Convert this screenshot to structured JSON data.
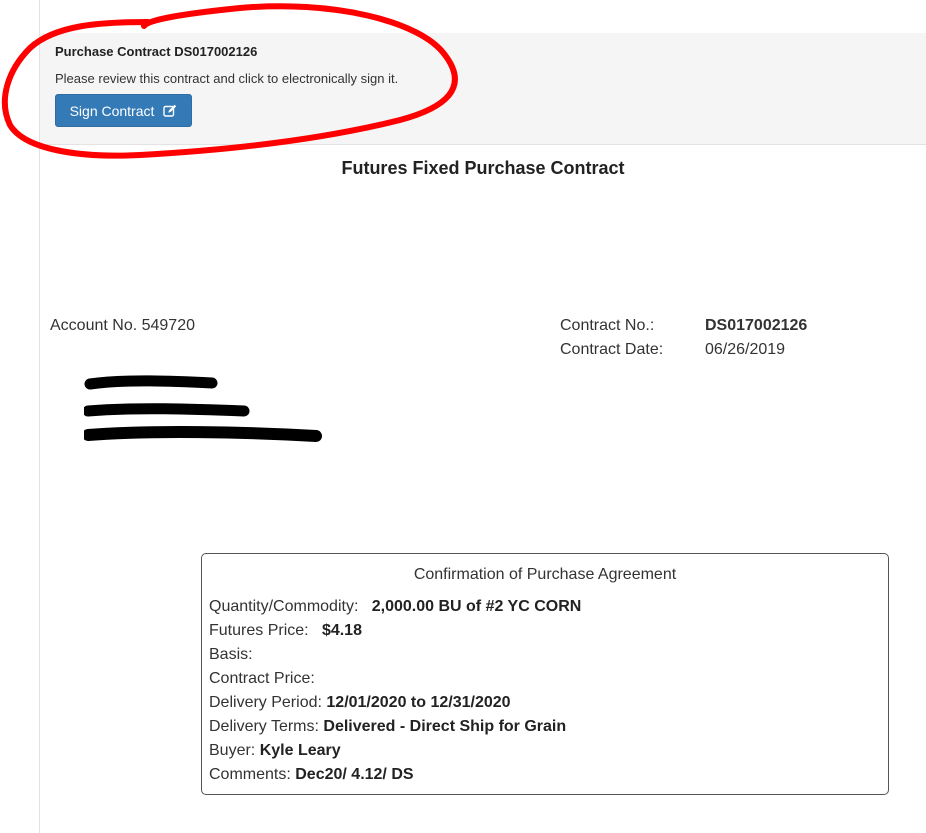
{
  "header": {
    "title": "Purchase Contract DS017002126",
    "description": "Please review this contract and click to electronically sign it.",
    "sign_button_label": "Sign Contract",
    "sign_button_icon": "edit-icon"
  },
  "document": {
    "title": "Futures Fixed Purchase Contract",
    "account": "Account No. 549720",
    "contract_no_label": "Contract No.:",
    "contract_no_value": "DS017002126",
    "contract_date_label": "Contract Date:",
    "contract_date_value": "06/26/2019"
  },
  "confirmation": {
    "title": "Confirmation of Purchase Agreement",
    "rows": [
      {
        "label": "Quantity/Commodity:",
        "value": "2,000.00 BU of #2 YC CORN"
      },
      {
        "label": "Futures Price:",
        "value": "$4.18"
      },
      {
        "label": "Basis:",
        "value": ""
      },
      {
        "label": "Contract Price:",
        "value": ""
      },
      {
        "label": "Delivery Period:",
        "value": "12/01/2020 to 12/31/2020"
      },
      {
        "label": "Delivery Terms:",
        "value": "Delivered - Direct Ship for Grain"
      },
      {
        "label": "Buyer:",
        "value": "Kyle Leary"
      },
      {
        "label": "Comments:",
        "value": "Dec20/ 4.12/ DS"
      }
    ]
  },
  "colors": {
    "primary_button": "#337ab7",
    "annotation": "#ff0000",
    "panel_bg": "#f5f5f5"
  }
}
